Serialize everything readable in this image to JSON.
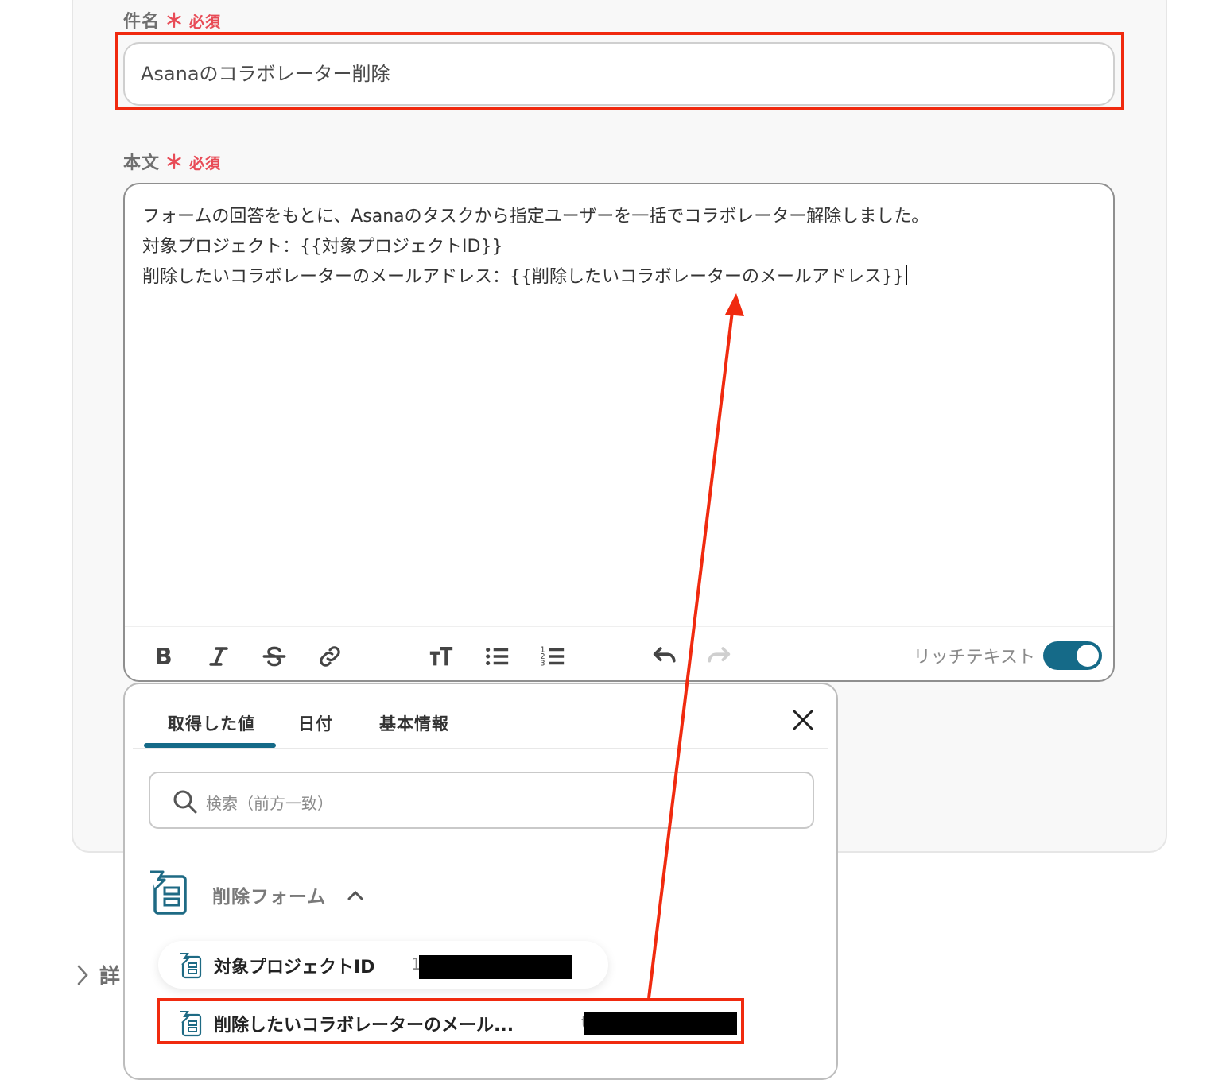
{
  "subject": {
    "label": "件名",
    "required_mark": "＊",
    "required_text": "必須",
    "value": "Asanaのコラボレーター削除"
  },
  "body": {
    "label": "本文",
    "required_mark": "＊",
    "required_text": "必須",
    "value": "フォームの回答をもとに、Asanaのタスクから指定ユーザーを一括でコラボレーター解除しました。\n対象プロジェクト：{{対象プロジェクトID}}\n削除したいコラボレーターのメールアドレス：{{削除したいコラボレーターのメールアドレス}}"
  },
  "toolbar": {
    "buttons": [
      "bold-icon",
      "italic-icon",
      "strikethrough-icon",
      "link-icon",
      "text-size-icon",
      "bullet-list-icon",
      "numbered-list-icon",
      "undo-icon",
      "redo-icon"
    ],
    "rich_text_label": "リッチテキスト",
    "rich_text_enabled": true
  },
  "popup": {
    "tabs": [
      "取得した値",
      "日付",
      "基本情報"
    ],
    "active_tab": "取得した値",
    "search_placeholder": "検索（前方一致）",
    "group": {
      "label": "削除フォーム",
      "expanded": true,
      "items": [
        {
          "label": "対象プロジェクトID",
          "value_prefix": "1"
        },
        {
          "label": "削除したいコラボレーターのメール...",
          "value_prefix": "t"
        }
      ]
    }
  },
  "details": {
    "label": "詳"
  },
  "annotation_color": "#f02a0f",
  "accent_color": "#156a88"
}
